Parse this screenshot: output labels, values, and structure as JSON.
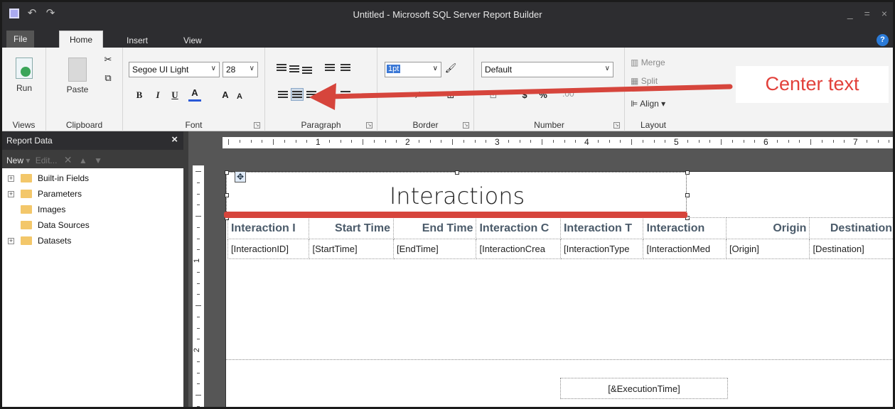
{
  "window": {
    "title": "Untitled - Microsoft SQL Server Report Builder"
  },
  "tabs": {
    "file": "File",
    "home": "Home",
    "insert": "Insert",
    "view": "View",
    "help": "?"
  },
  "ribbon": {
    "views": {
      "run": "Run",
      "group": "Views"
    },
    "clipboard": {
      "paste": "Paste",
      "group": "Clipboard"
    },
    "font": {
      "family": "Segoe UI Light",
      "size": "28",
      "bold": "B",
      "italic": "I",
      "underline": "U",
      "color": "A",
      "grow": "A",
      "shrink": "A",
      "group": "Font"
    },
    "paragraph": {
      "group": "Paragraph"
    },
    "border": {
      "width": "1pt",
      "group": "Border"
    },
    "number": {
      "format": "Default",
      "currency": "$",
      "percent": "%",
      "group": "Number"
    },
    "layout": {
      "merge": "Merge",
      "split": "Split",
      "align": "Align",
      "group": "Layout"
    }
  },
  "report_data": {
    "title": "Report Data",
    "toolbar": {
      "new": "New",
      "edit": "Edit..."
    },
    "tree": [
      {
        "label": "Built-in Fields",
        "expandable": true
      },
      {
        "label": "Parameters",
        "expandable": true
      },
      {
        "label": "Images",
        "expandable": false
      },
      {
        "label": "Data Sources",
        "expandable": false
      },
      {
        "label": "Datasets",
        "expandable": true
      }
    ]
  },
  "ruler": {
    "marks": [
      "1",
      "2",
      "3",
      "4",
      "5",
      "6",
      "7"
    ],
    "vertical": [
      "1",
      "2"
    ]
  },
  "report": {
    "title": "Interactions",
    "headers": [
      "Interaction I",
      "Start Time",
      "End Time",
      "Interaction C",
      "Interaction T",
      "Interaction",
      "Origin",
      "Destination"
    ],
    "fields": [
      "[InteractionID]",
      "[StartTime]",
      "[EndTime]",
      "[InteractionCrea",
      "[InteractionType",
      "[InteractionMed",
      "[Origin]",
      "[Destination]"
    ],
    "footer_field": "[&ExecutionTime]"
  },
  "annotation": {
    "callout": "Center text",
    "color": "#e2403a"
  }
}
